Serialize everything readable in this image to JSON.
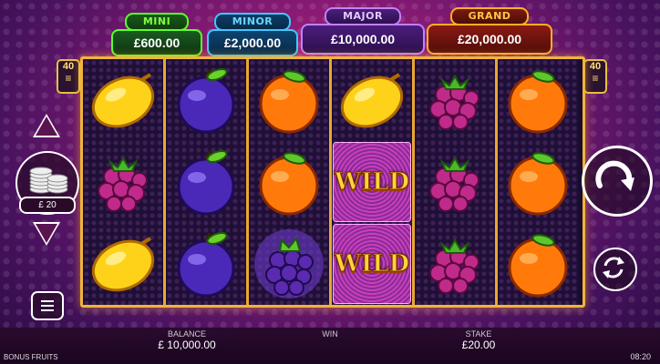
{
  "jackpots": {
    "mini": {
      "label": "MINI",
      "value": "£600.00"
    },
    "minor": {
      "label": "MINOR",
      "value": "£2,000.00"
    },
    "major": {
      "label": "MAJOR",
      "value": "£10,000.00"
    },
    "grand": {
      "label": "GRAND",
      "value": "£20,000.00"
    }
  },
  "paylines": {
    "count": "40"
  },
  "reels": [
    [
      "lemon",
      "raspberry",
      "lemon"
    ],
    [
      "plum",
      "plum",
      "plum"
    ],
    [
      "orange",
      "orange",
      "grapes"
    ],
    [
      "lemon",
      "wild",
      "wild"
    ],
    [
      "raspberry",
      "raspberry",
      "raspberry"
    ],
    [
      "orange",
      "orange",
      "orange"
    ]
  ],
  "wild_text": "WILD",
  "stake_selector": {
    "label": "£ 20"
  },
  "footer": {
    "balance_label": "BALANCE",
    "balance_value": "£ 10,000.00",
    "win_label": "WIN",
    "stake_label": "STAKE",
    "stake_value": "£20.00",
    "game_name": "BONUS FRUITS",
    "clock": "08:20"
  },
  "colors": {
    "frame": "#f0b43a",
    "mini": "#5dff2a",
    "minor": "#40c8ff",
    "major": "#c080ff",
    "grand": "#ffb020"
  },
  "icons": {
    "spin": "spin-arrow-icon",
    "autoplay": "autoplay-icon",
    "menu": "menu-icon",
    "coins": "coin-stack-icon"
  }
}
